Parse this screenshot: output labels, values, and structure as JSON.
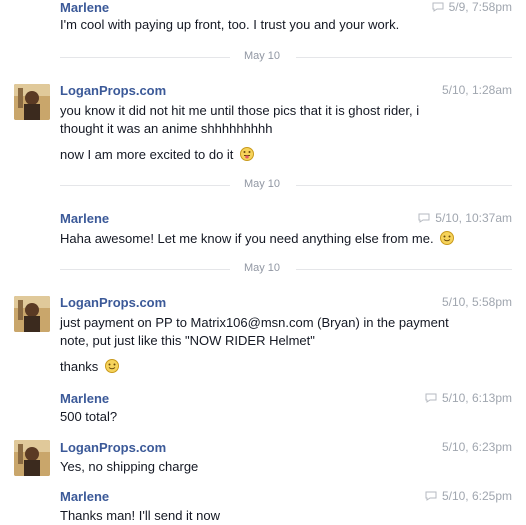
{
  "messages": [
    {
      "sender": "Marlene",
      "time": "5/9, 7:58pm",
      "lines": [
        "I'm cool with paying up front, too. I trust you and your work."
      ]
    },
    {
      "divider": "May 10"
    },
    {
      "sender": "LoganProps.com",
      "time": "5/10, 1:28am",
      "lines": [
        "you know it did not hit me until those pics that it is ghost rider, i",
        "thought it was an anime shhhhhhhhh",
        "now I am more excited to do it"
      ]
    },
    {
      "divider": "May 10"
    },
    {
      "sender": "Marlene",
      "time": "5/10, 10:37am",
      "lines": [
        "Haha awesome! Let me know if you need anything else from me."
      ]
    },
    {
      "divider": "May 10"
    },
    {
      "sender": "LoganProps.com",
      "time": "5/10, 5:58pm",
      "lines": [
        "just payment on PP to Matrix106@msn.com  (Bryan) in the payment",
        "note, put just like this \"NOW RIDER Helmet\"",
        "thanks"
      ]
    },
    {
      "sender": "Marlene",
      "time": "5/10, 6:13pm",
      "lines": [
        "500 total?"
      ]
    },
    {
      "sender": "LoganProps.com",
      "time": "5/10, 6:23pm",
      "lines": [
        "Yes, no shipping charge"
      ]
    },
    {
      "sender": "Marlene",
      "time": "5/10, 6:25pm",
      "lines": [
        "Thanks man! I'll send it now"
      ]
    }
  ],
  "icons": {
    "read_receipt": "chat-bubble-icon",
    "emoji_tongue": "tongue-emoji-icon",
    "emoji_smile": "smile-emoji-icon"
  }
}
